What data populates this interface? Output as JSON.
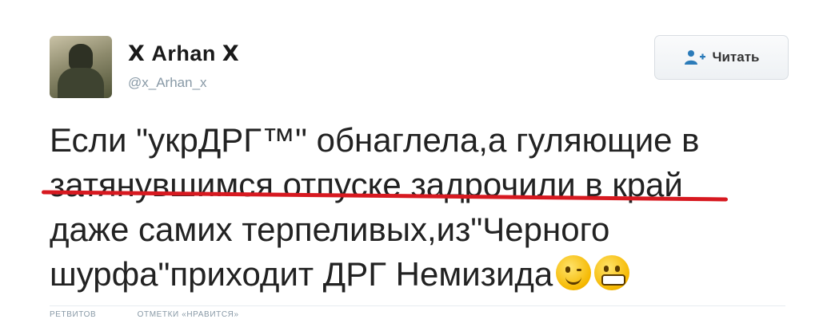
{
  "tweet": {
    "author": {
      "display_name": "ꓫ Arhan ꓫ",
      "handle": "@x_Arhan_x"
    },
    "follow_button": {
      "label": "Читать",
      "icon": "add-user-icon"
    },
    "text_lines": [
      "Если \"укрДРГ™\" обнаглела,а гуляющие в",
      "затянувшимся отпуске задрочили  в край",
      "даже самих терпеливых,из\"Черного",
      "шурфа\"приходит ДРГ Немизида"
    ],
    "emojis": [
      "winking-face",
      "grimacing-face"
    ],
    "stats": {
      "retweets_label": "РЕТВИТОВ",
      "likes_label": "ОТМЕТКИ «НРАВИТСЯ»"
    },
    "highlight_color": "#d71920"
  }
}
